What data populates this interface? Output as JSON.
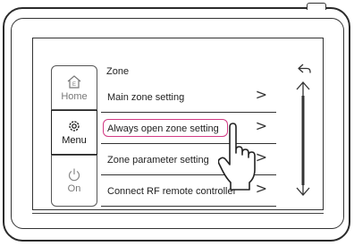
{
  "menu": {
    "home": {
      "label": "Home",
      "icon": "home-icon"
    },
    "menu": {
      "label": "Menu",
      "icon": "gear-icon"
    },
    "on": {
      "label": "On",
      "icon": "power-icon"
    }
  },
  "zone_screen": {
    "title": "Zone",
    "items": [
      {
        "label": "Main zone setting",
        "chevron": ">"
      },
      {
        "label": "Always open zone setting",
        "chevron": ">"
      },
      {
        "label": "Zone parameter setting",
        "chevron": ">"
      },
      {
        "label": "Connect RF remote controller",
        "chevron": ">"
      }
    ],
    "highlighted_index": 1
  },
  "icons": {
    "back": "back-arrow-icon",
    "scroll": "scrollbar-icon",
    "hand": "pointing-hand-icon"
  },
  "colors": {
    "highlight": "#d23a84",
    "line": "#333333"
  }
}
